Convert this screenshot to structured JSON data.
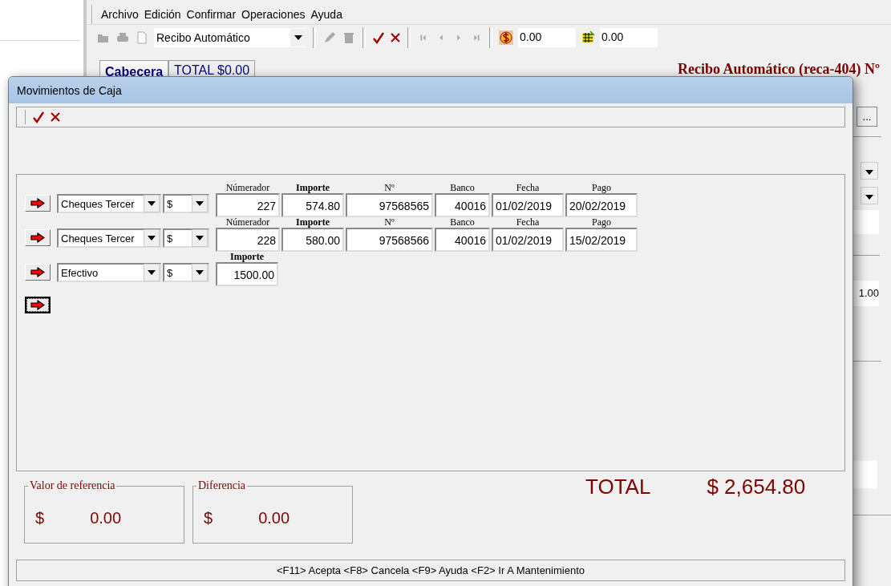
{
  "background_window": {
    "menu": [
      "Archivo",
      "Edición",
      "Confirmar",
      "Operaciones",
      "Ayuda"
    ],
    "toolbar": {
      "document_type": "Recibo Automático",
      "amount_1": "0.00",
      "amount_2": "0.00"
    },
    "tabs": [
      {
        "label": "Cabecera",
        "selected": true
      },
      {
        "label": "TOTAL $0.00",
        "selected": false
      }
    ],
    "title": "Recibo Automático (reca-404) Nº",
    "side_button": "...",
    "side_value": "1.00"
  },
  "dialog": {
    "title": "Movimientos de Caja",
    "movements": [
      {
        "type": "Cheques Tercer",
        "currency": "$",
        "fields": [
          {
            "kind": "counter",
            "label": "Númerador",
            "value": "227"
          },
          {
            "kind": "amount",
            "label": "Importe",
            "value": "574.80"
          },
          {
            "kind": "cheque",
            "label": "Nº",
            "value": "97568565"
          },
          {
            "kind": "bank",
            "label": "Banco",
            "value": "40016"
          },
          {
            "kind": "date",
            "label": "Fecha",
            "value": "01/02/2019"
          },
          {
            "kind": "date",
            "label": "Pago",
            "value": "20/02/2019"
          }
        ]
      },
      {
        "type": "Cheques Tercer",
        "currency": "$",
        "fields": [
          {
            "kind": "counter",
            "label": "Númerador",
            "value": "228"
          },
          {
            "kind": "amount",
            "label": "Importe",
            "value": "580.00"
          },
          {
            "kind": "cheque",
            "label": "Nº",
            "value": "97568566"
          },
          {
            "kind": "bank",
            "label": "Banco",
            "value": "40016"
          },
          {
            "kind": "date",
            "label": "Fecha",
            "value": "01/02/2019"
          },
          {
            "kind": "date",
            "label": "Pago",
            "value": "15/02/2019"
          }
        ]
      },
      {
        "type": "Efectivo",
        "currency": "$",
        "fields": [
          {
            "kind": "amount",
            "label": "Importe",
            "value": "1500.00"
          }
        ]
      }
    ],
    "add_button": {
      "focused": true
    },
    "reference": {
      "label": "Valor de referencia",
      "currency": "$",
      "value": "0.00"
    },
    "difference": {
      "label": "Diferencia",
      "currency": "$",
      "value": "0.00"
    },
    "total": {
      "label": "TOTAL",
      "value": "$ 2,654.80"
    },
    "status": "<F11> Acepta <F8> Cancela <F9> Ayuda <F2> Ir A Mantenimiento"
  }
}
